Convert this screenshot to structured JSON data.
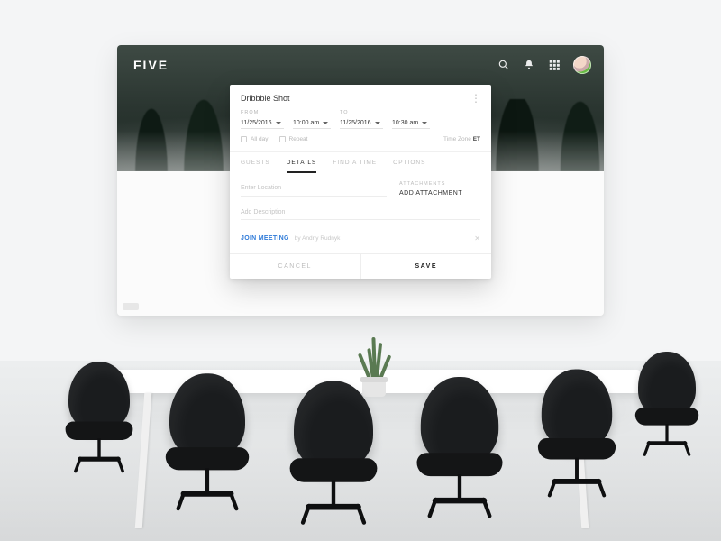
{
  "brand": "FIVE",
  "header_icons": {
    "search": "search-icon",
    "bell": "bell-icon",
    "grid": "grid-icon"
  },
  "modal": {
    "title": "Dribbble Shot",
    "from_label": "FROM",
    "to_label": "TO",
    "from_date": "11/25/2016",
    "from_time": "10:00 am",
    "to_date": "11/25/2016",
    "to_time": "10:30 am",
    "all_day_label": "All day",
    "repeat_label": "Repeat",
    "timezone_label": "Time Zone",
    "timezone_value": "ET",
    "tabs": [
      "GUESTS",
      "DETAILS",
      "FIND A TIME",
      "OPTIONS"
    ],
    "active_tab_index": 1,
    "location_placeholder": "Enter Location",
    "attachments_label": "ATTACHMENTS",
    "add_attachment": "ADD ATTACHMENT",
    "description_placeholder": "Add Description",
    "join_label": "JOIN MEETING",
    "join_by": "by Andriy Rudnyk",
    "cancel": "CANCEL",
    "save": "SAVE"
  }
}
